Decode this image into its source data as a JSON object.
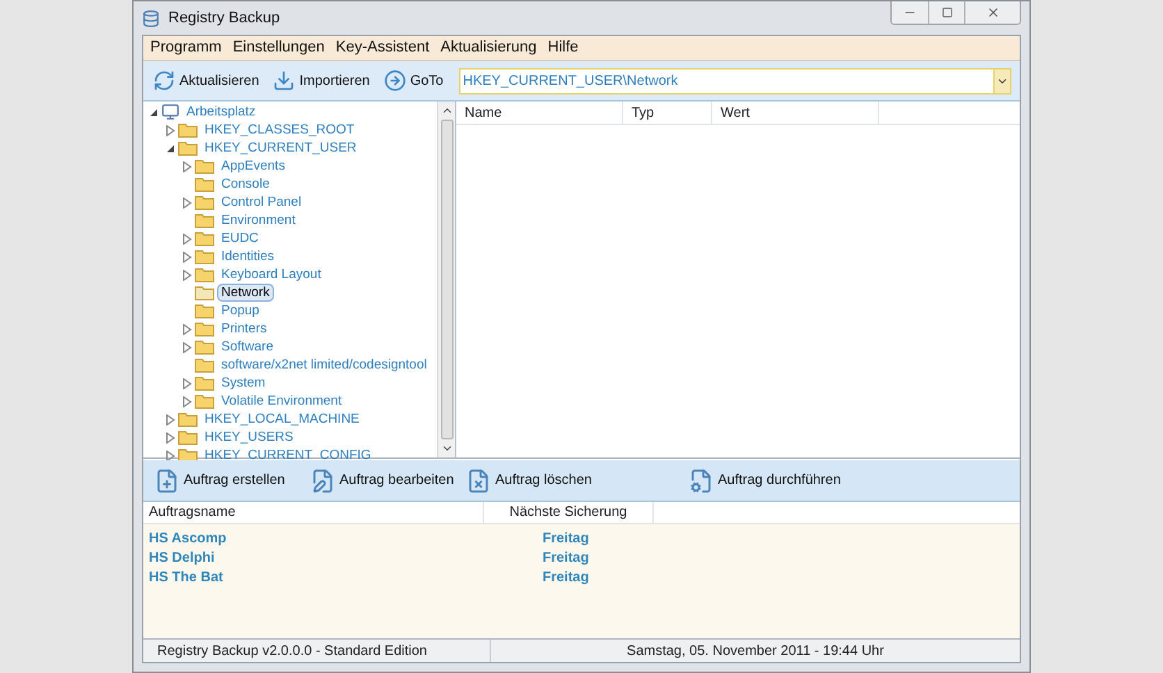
{
  "window": {
    "title": "Registry Backup"
  },
  "menu": [
    "Programm",
    "Einstellungen",
    "Key-Assistent",
    "Aktualisierung",
    "Hilfe"
  ],
  "toolbar": {
    "buttons": [
      "Aktualisieren",
      "Importieren",
      "GoTo"
    ],
    "path_field": {
      "value": "HKEY_CURRENT_USER\\Network"
    }
  },
  "tree": [
    {
      "label": "Arbeitsplatz",
      "kind": "expanded",
      "selected": false,
      "children": [
        {
          "label": "HKEY_CLASSES_ROOT",
          "kind": "collapsed",
          "selected": false
        },
        {
          "label": "HKEY_CURRENT_USER",
          "kind": "expanded",
          "selected": false,
          "children": [
            {
              "label": "AppEvents",
              "kind": "collapsed",
              "selected": false
            },
            {
              "label": "Console",
              "kind": "leaf",
              "selected": false
            },
            {
              "label": "Control Panel",
              "kind": "collapsed",
              "selected": false
            },
            {
              "label": "Environment",
              "kind": "leaf",
              "selected": false
            },
            {
              "label": "EUDC",
              "kind": "collapsed",
              "selected": false
            },
            {
              "label": "Identities",
              "kind": "collapsed",
              "selected": false
            },
            {
              "label": "Keyboard Layout",
              "kind": "collapsed",
              "selected": false
            },
            {
              "label": "Network",
              "kind": "leaf",
              "selected": true
            },
            {
              "label": "Popup",
              "kind": "leaf",
              "selected": false
            },
            {
              "label": "Printers",
              "kind": "collapsed",
              "selected": false
            },
            {
              "label": "Software",
              "kind": "collapsed",
              "selected": false
            },
            {
              "label": "software/x2net limited/codesigntool",
              "kind": "leaf",
              "selected": false
            },
            {
              "label": "System",
              "kind": "collapsed",
              "selected": false
            },
            {
              "label": "Volatile Environment",
              "kind": "collapsed",
              "selected": false
            }
          ]
        },
        {
          "label": "HKEY_LOCAL_MACHINE",
          "kind": "collapsed",
          "selected": false
        },
        {
          "label": "HKEY_USERS",
          "kind": "collapsed",
          "selected": false
        },
        {
          "label": "HKEY_CURRENT_CONFIG",
          "kind": "collapsed",
          "selected": false
        }
      ]
    }
  ],
  "values_table": {
    "columns": [
      "Name",
      "Typ",
      "Wert"
    ]
  },
  "task_toolbar": {
    "buttons": [
      "Auftrag erstellen",
      "Auftrag bearbeiten",
      "Auftrag löschen",
      "Auftrag durchführen"
    ]
  },
  "task_table": {
    "columns": [
      "Auftragsname",
      "Nächste Sicherung"
    ],
    "rows": [
      {
        "name": "HS Ascomp",
        "next": "Freitag"
      },
      {
        "name": "HS Delphi",
        "next": "Freitag"
      },
      {
        "name": "HS The Bat",
        "next": "Freitag"
      }
    ]
  },
  "status_bar": [
    "Registry Backup v2.0.0.0 - Standard Edition",
    "Samstag, 05. November 2011 - 19:44 Uhr"
  ]
}
